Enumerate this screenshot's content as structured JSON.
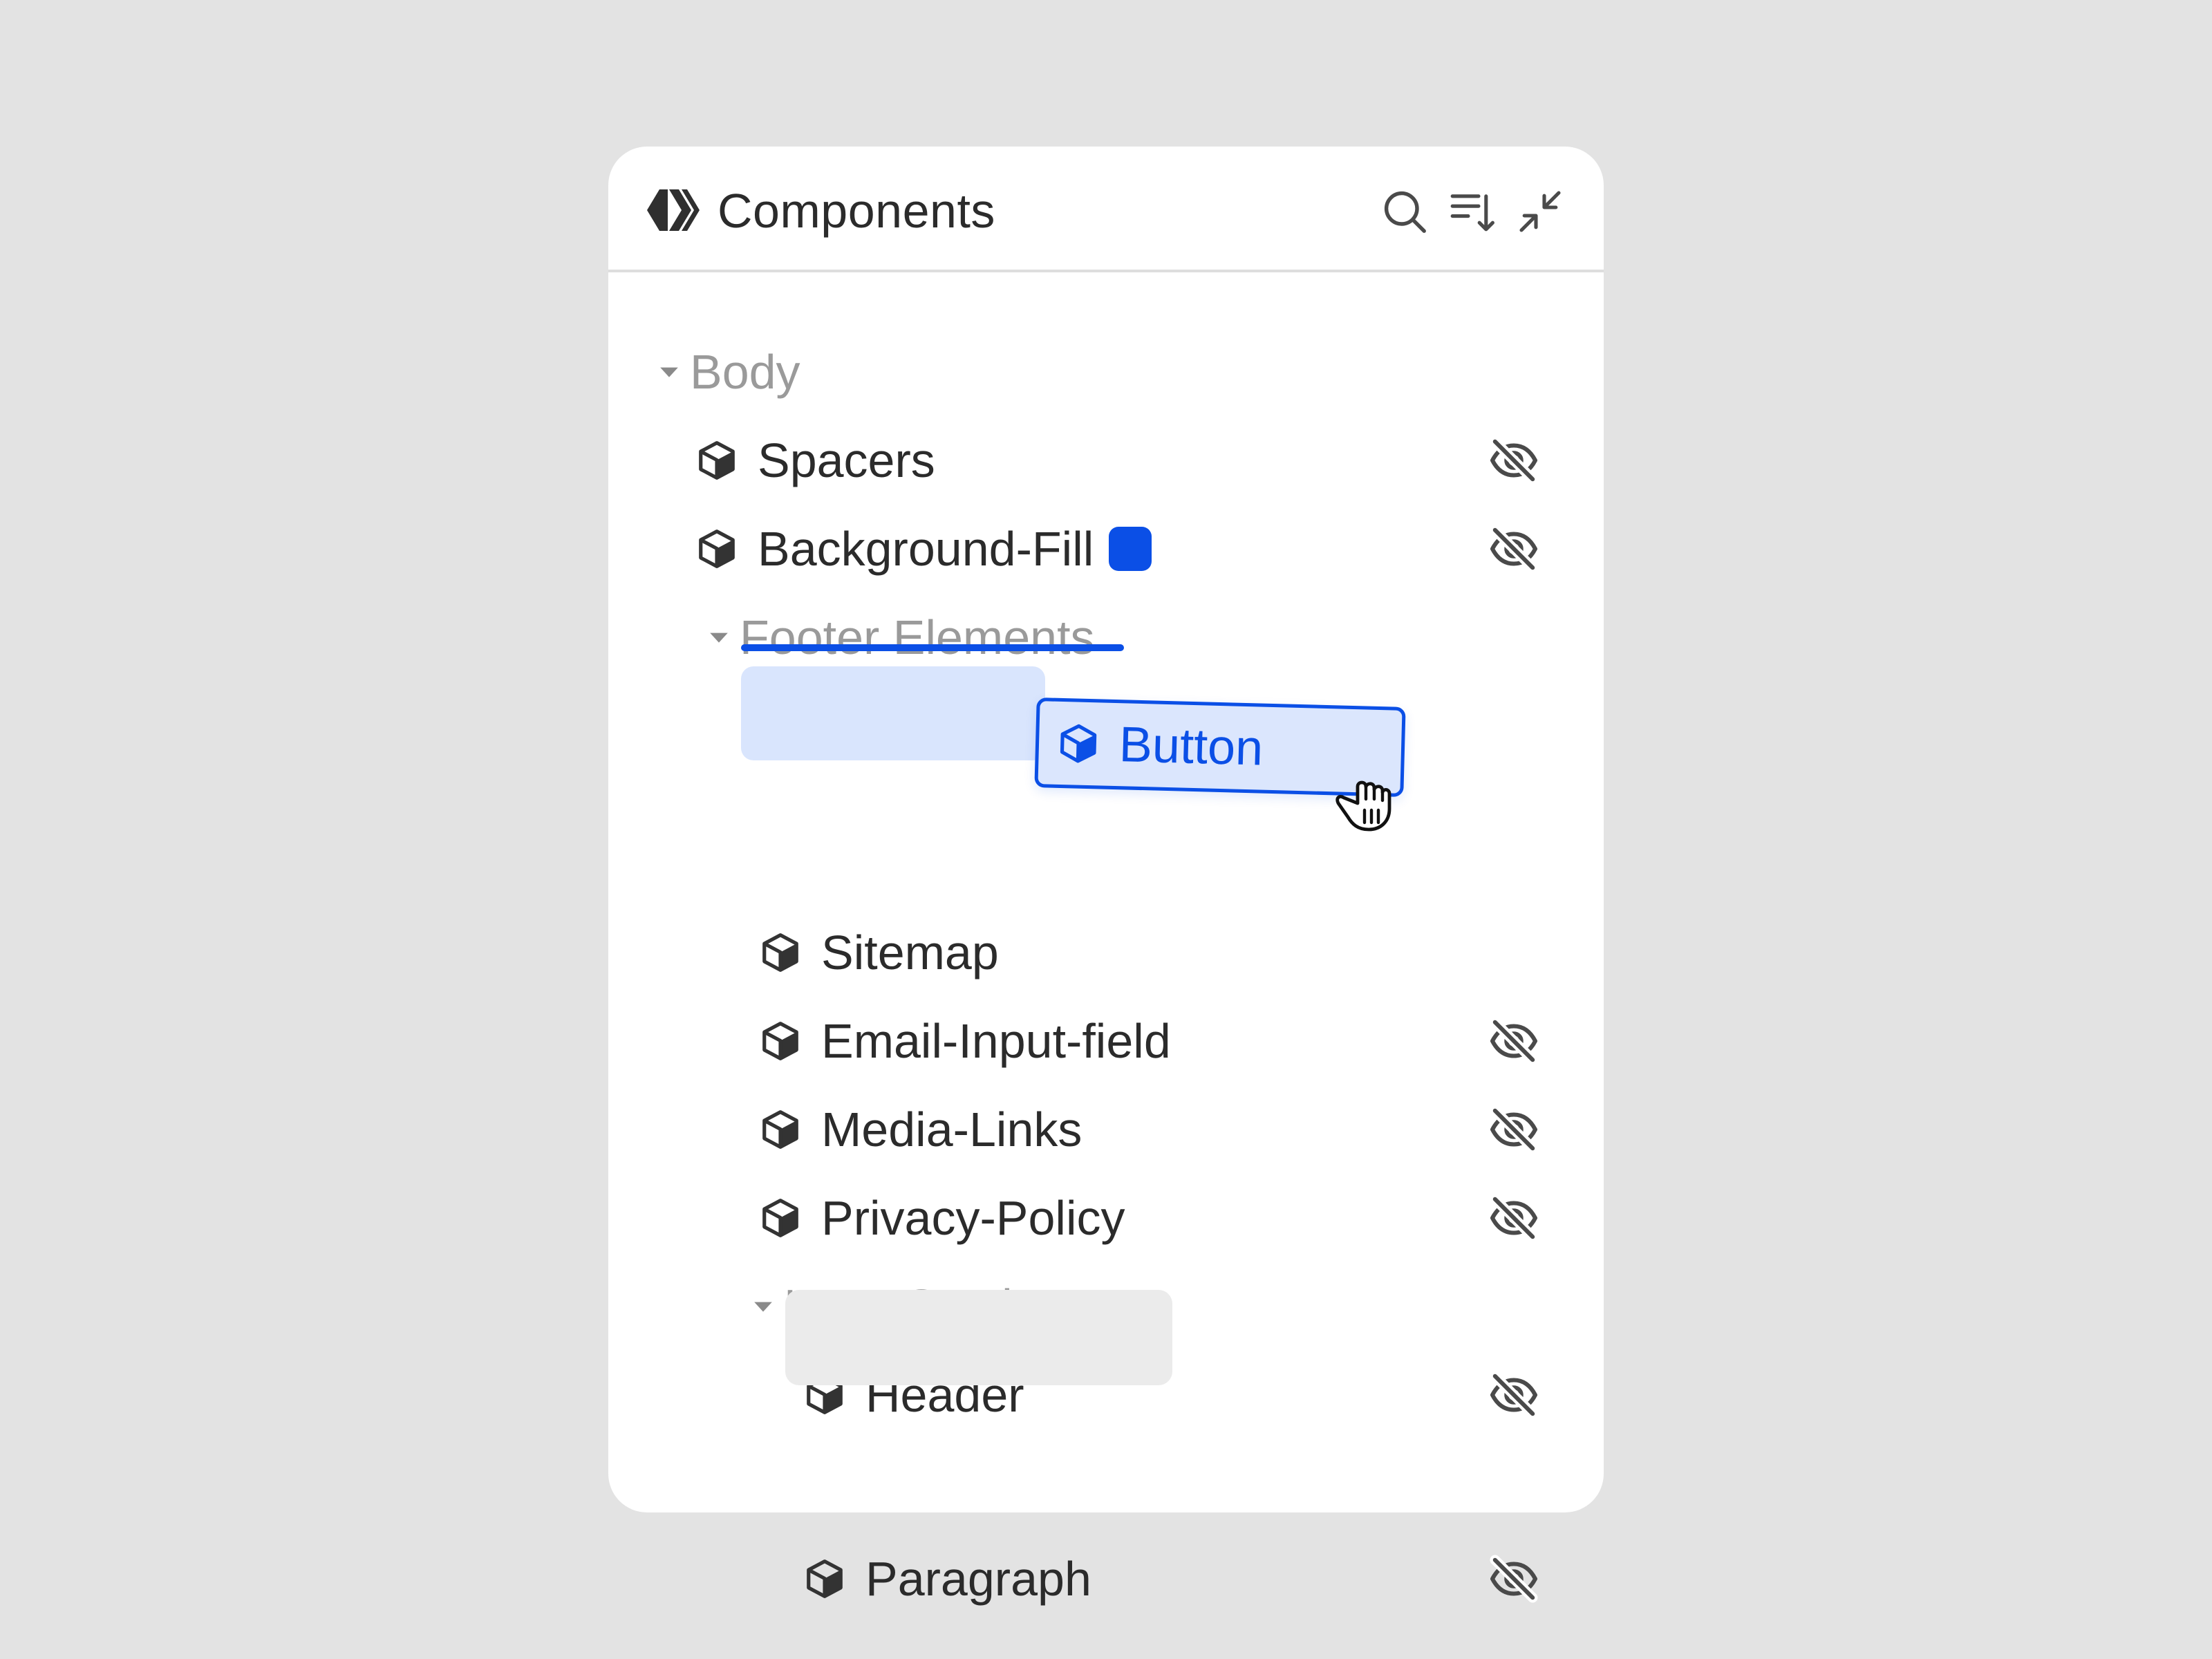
{
  "panel": {
    "title": "Components",
    "icons": [
      "brand-logo-icon",
      "search-icon",
      "sort-icon",
      "collapse-icon"
    ]
  },
  "tree": {
    "body": {
      "label": "Body"
    },
    "spacers": {
      "label": "Spacers",
      "hidden": true
    },
    "background_fill": {
      "label": "Background-Fill",
      "hidden": true,
      "color": "#0b4fe6"
    },
    "footer_elements": {
      "label": "Footer Elements"
    },
    "sitemap": {
      "label": "Sitemap",
      "hidden": false
    },
    "email_input_field": {
      "label": "Email-Input-field",
      "hidden": true
    },
    "media_links": {
      "label": "Media-Links",
      "hidden": true
    },
    "privacy_policy": {
      "label": "Privacy-Policy",
      "hidden": true
    },
    "hero_section": {
      "label": "Hero-Section"
    },
    "header": {
      "label": "Header",
      "hidden": true
    },
    "paragraph": {
      "label": "Paragraph",
      "hidden": true
    }
  },
  "drag": {
    "label": "Button",
    "icon": "cube-icon",
    "cursor": "grab-cursor-icon"
  },
  "colors": {
    "accent": "#0b4fe6",
    "placeholder": "#d9e5fd",
    "empty_slot": "#ebebeb",
    "text": "#2b2b2b",
    "muted": "#9a9a9a"
  }
}
